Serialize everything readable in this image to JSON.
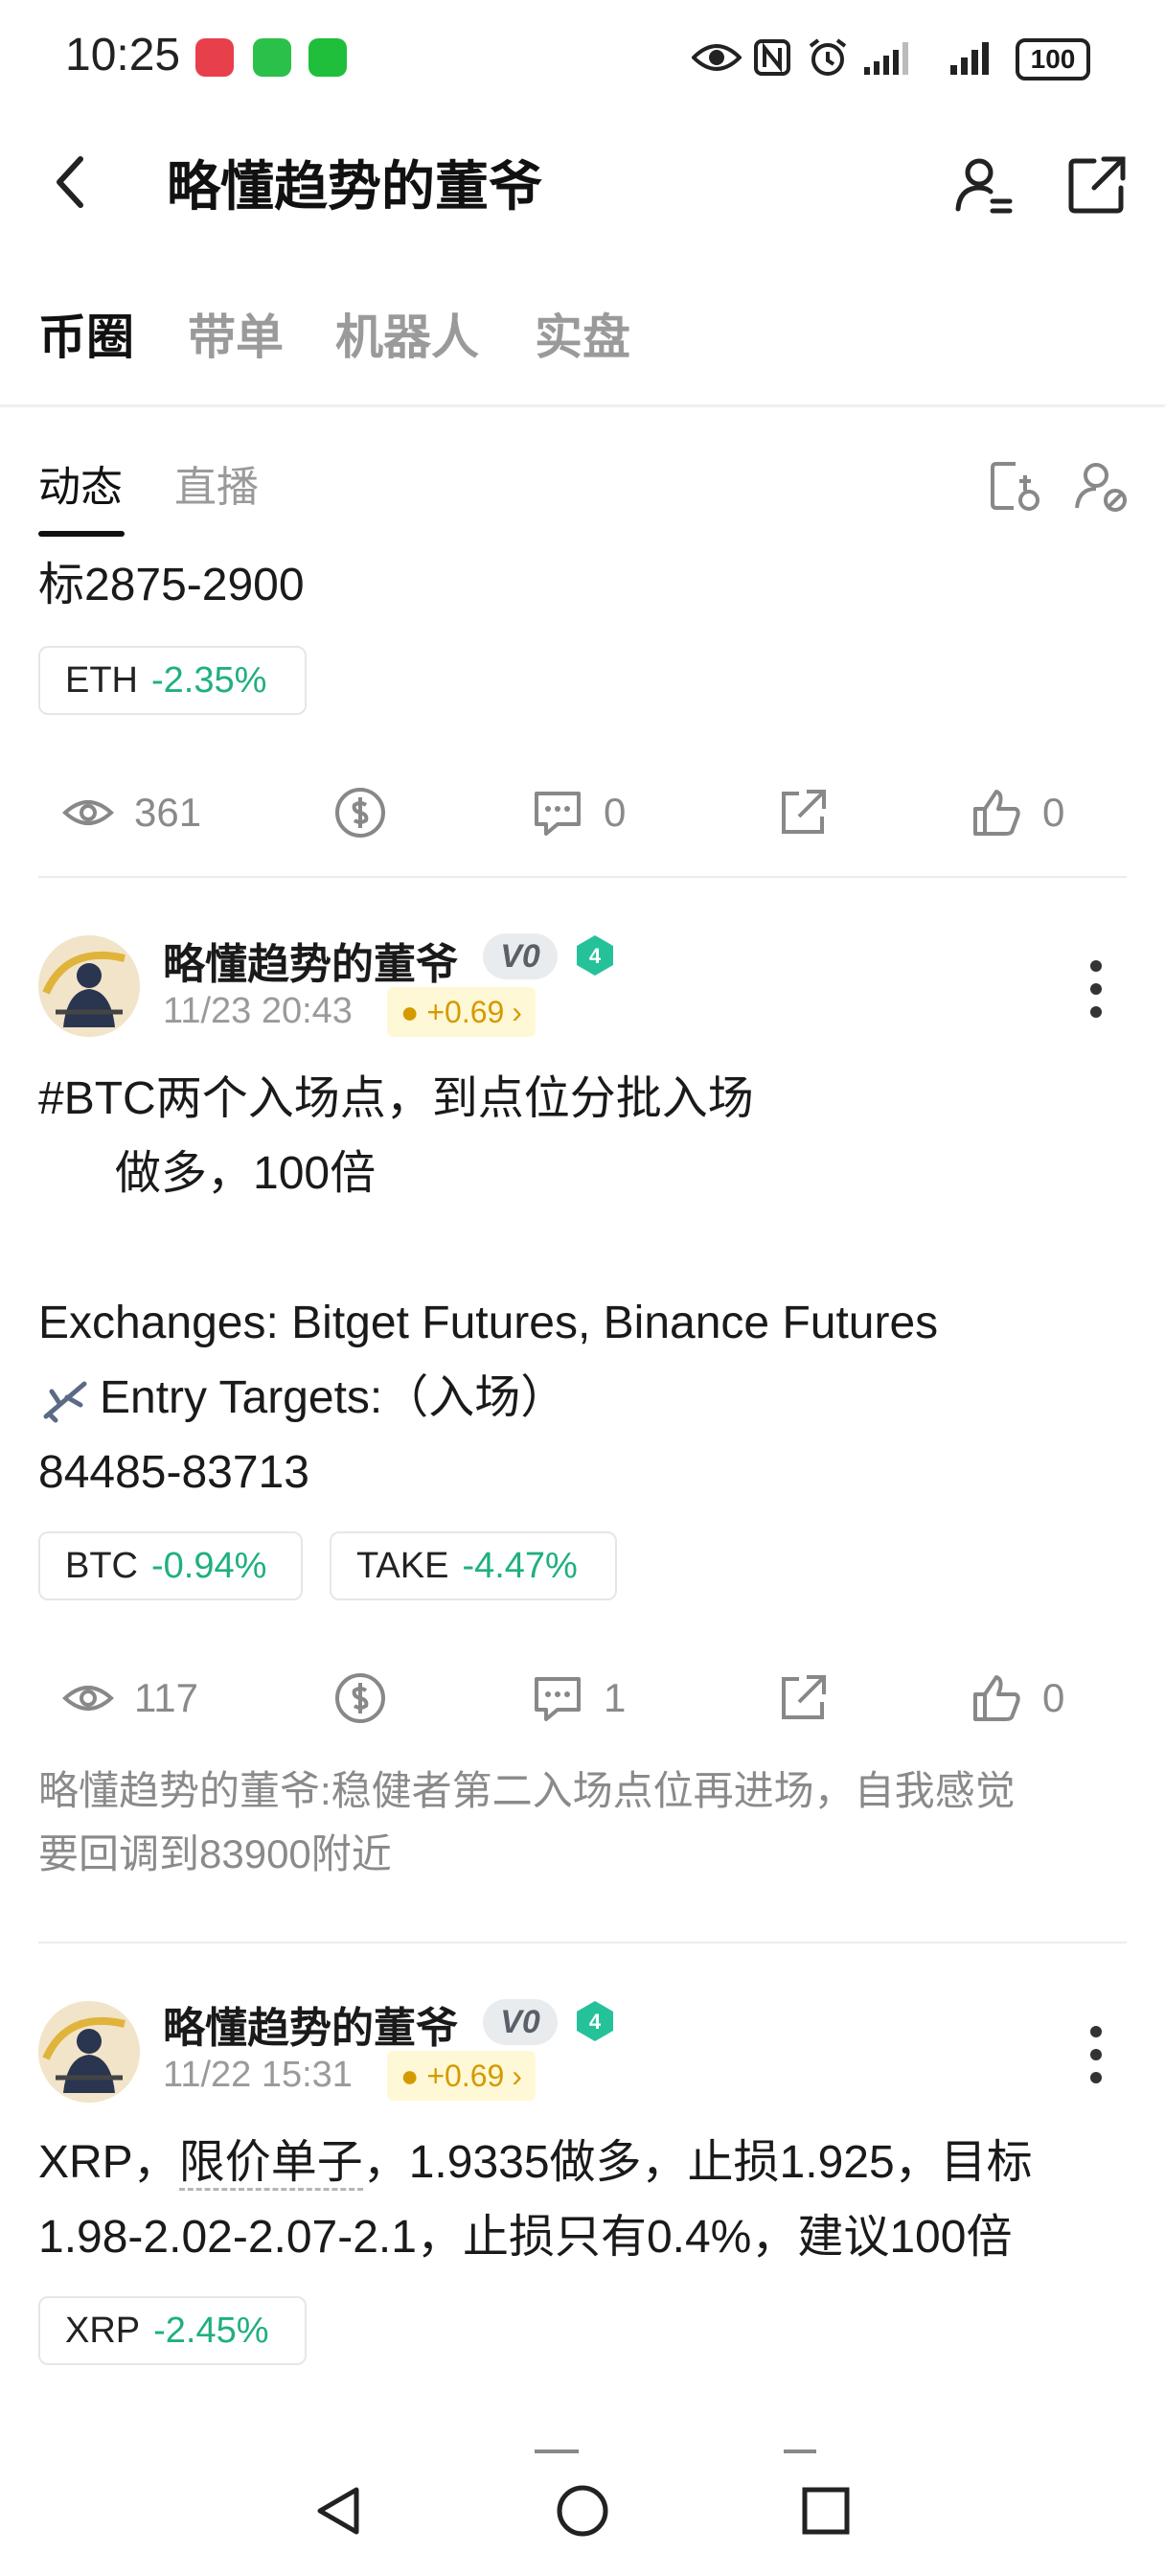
{
  "status_bar": {
    "time": "10:25",
    "battery": "100",
    "app_icons": [
      "huawei-app-icon",
      "chat-app-icon",
      "wechat-icon"
    ],
    "system_icons": [
      "eye-icon",
      "nfc-icon",
      "alarm-icon",
      "signal-icon",
      "signal-icon"
    ]
  },
  "header": {
    "title": "略懂趋势的董爷",
    "icons": [
      "back-icon",
      "user-settings-icon",
      "share-icon"
    ]
  },
  "tabs": [
    {
      "label": "币圈",
      "active": true
    },
    {
      "label": "带单",
      "active": false
    },
    {
      "label": "机器人",
      "active": false
    },
    {
      "label": "实盘",
      "active": false
    }
  ],
  "subtabs": [
    {
      "label": "动态",
      "active": true
    },
    {
      "label": "直播",
      "active": false
    }
  ],
  "colors": {
    "positive_green": "#1fb07d",
    "reward_gold": "#d49a00",
    "muted": "#8a8a8a"
  },
  "posts": [
    {
      "text_lines": [
        "标2875-2900"
      ],
      "tickers": [
        {
          "symbol": "ETH",
          "change": "-2.35%"
        }
      ],
      "views": "361",
      "comments": "0",
      "likes": "0"
    },
    {
      "author": "略懂趋势的董爷",
      "vip": "V0",
      "level": "4",
      "date": "11/23 20:43",
      "reward": "+0.69",
      "text_lines": [
        "#BTC两个入场点，到点位分批入场",
        "      做多，100倍",
        "",
        "Exchanges: Bitget Futures, Binance Futures",
        "Entry Targets:（入场）",
        "84485-83713"
      ],
      "tickers": [
        {
          "symbol": "BTC",
          "change": "-0.94%"
        },
        {
          "symbol": "TAKE",
          "change": "-4.47%"
        }
      ],
      "views": "117",
      "comments": "1",
      "likes": "0",
      "comment_preview": [
        "略懂趋势的董爷:稳健者第二入场点位再进场，自我感觉",
        "要回调到83900附近"
      ]
    },
    {
      "author": "略懂趋势的董爷",
      "vip": "V0",
      "level": "4",
      "date": "11/22 15:31",
      "reward": "+0.69",
      "text_before": "XRP，",
      "text_underlined": "限价单子",
      "text_after": "，1.9335做多，止损1.925，目标",
      "text_line2": "1.98-2.02-2.07-2.1，止损只有0.4%，建议100倍",
      "tickers": [
        {
          "symbol": "XRP",
          "change": "-2.45%"
        }
      ]
    }
  ],
  "nav": {
    "buttons": [
      "back-triangle-icon",
      "home-circle-icon",
      "recents-square-icon"
    ]
  }
}
